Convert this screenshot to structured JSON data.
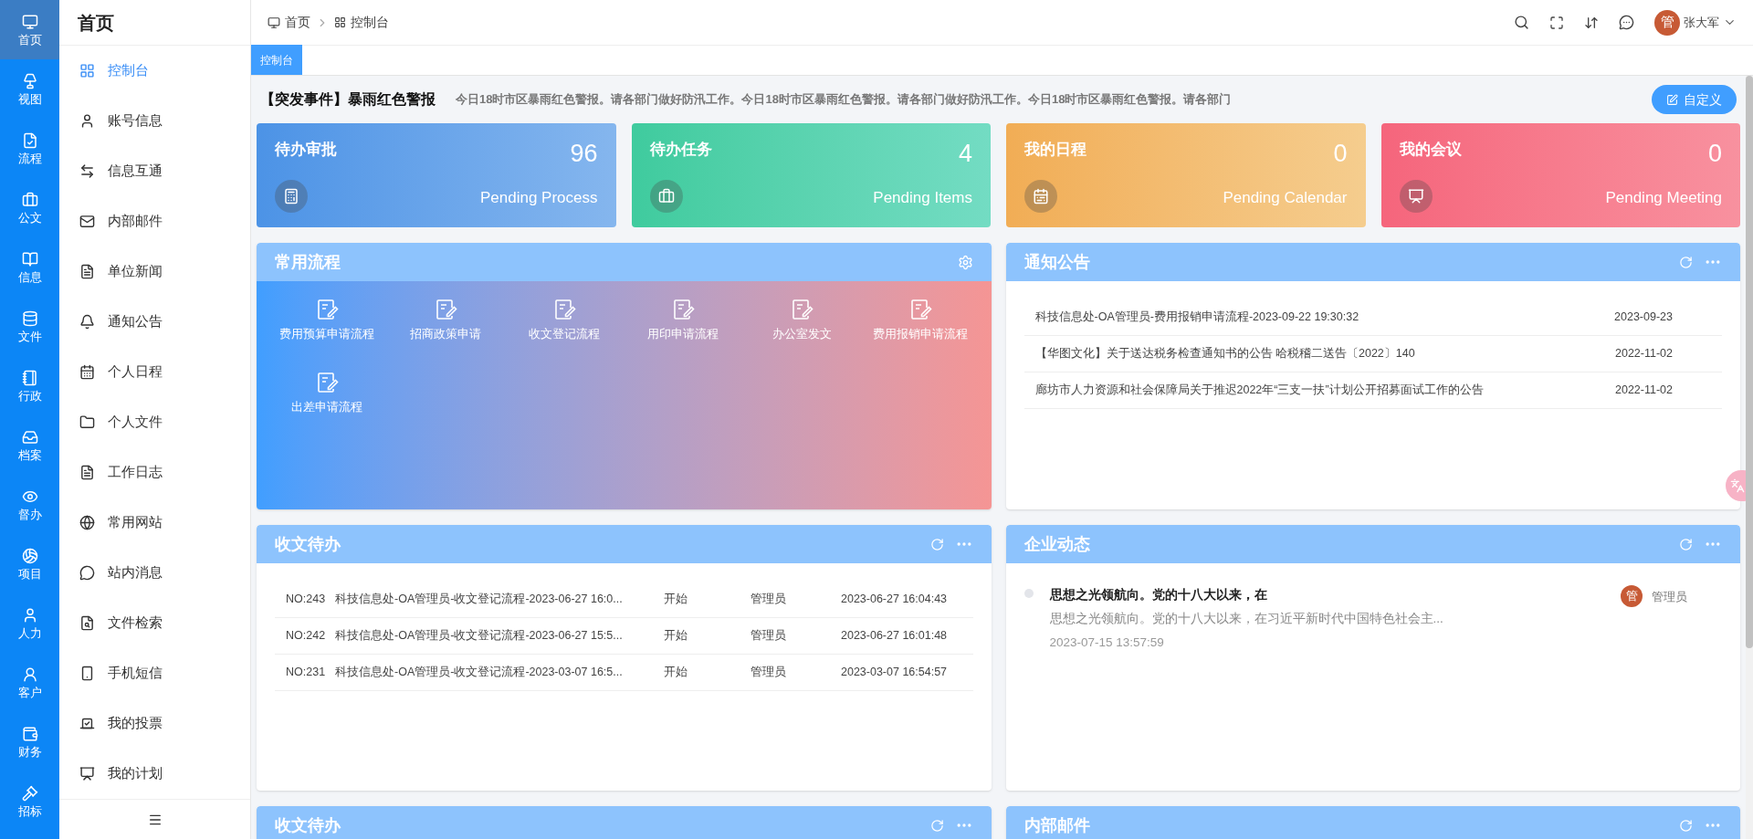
{
  "rail": [
    {
      "label": "首页",
      "selected": true
    },
    {
      "label": "视图",
      "selected": false
    },
    {
      "label": "流程",
      "selected": false
    },
    {
      "label": "公文",
      "selected": false
    },
    {
      "label": "信息",
      "selected": false
    },
    {
      "label": "文件",
      "selected": false
    },
    {
      "label": "行政",
      "selected": false
    },
    {
      "label": "档案",
      "selected": false
    },
    {
      "label": "督办",
      "selected": false
    },
    {
      "label": "项目",
      "selected": false
    },
    {
      "label": "人力",
      "selected": false
    },
    {
      "label": "客户",
      "selected": false
    },
    {
      "label": "财务",
      "selected": false
    },
    {
      "label": "招标",
      "selected": false
    }
  ],
  "sidebar": {
    "title": "首页",
    "items": [
      {
        "label": "控制台",
        "selected": true
      },
      {
        "label": "账号信息",
        "selected": false
      },
      {
        "label": "信息互通",
        "selected": false
      },
      {
        "label": "内部邮件",
        "selected": false
      },
      {
        "label": "单位新闻",
        "selected": false
      },
      {
        "label": "通知公告",
        "selected": false
      },
      {
        "label": "个人日程",
        "selected": false
      },
      {
        "label": "个人文件",
        "selected": false
      },
      {
        "label": "工作日志",
        "selected": false
      },
      {
        "label": "常用网站",
        "selected": false
      },
      {
        "label": "站内消息",
        "selected": false
      },
      {
        "label": "文件检索",
        "selected": false
      },
      {
        "label": "手机短信",
        "selected": false
      },
      {
        "label": "我的投票",
        "selected": false
      },
      {
        "label": "我的计划",
        "selected": false
      }
    ]
  },
  "breadcrumb": [
    "首页",
    "控制台"
  ],
  "user": {
    "avatar_text": "管",
    "name": "张大军"
  },
  "tabs": [
    {
      "label": "控制台",
      "selected": true
    }
  ],
  "alert": {
    "title": "【突发事件】暴雨红色警报",
    "text": "今日18时市区暴雨红色警报。请各部门做好防汛工作。今日18时市区暴雨红色警报。请各部门做好防汛工作。今日18时市区暴雨红色警报。请各部门"
  },
  "customize_button": "自定义",
  "stat_cards": [
    {
      "kind": "approval",
      "title": "待办审批",
      "count": "96",
      "subtitle": "Pending Process"
    },
    {
      "kind": "task",
      "title": "待办任务",
      "count": "4",
      "subtitle": "Pending Items"
    },
    {
      "kind": "calendar",
      "title": "我的日程",
      "count": "0",
      "subtitle": "Pending Calendar"
    },
    {
      "kind": "meeting",
      "title": "我的会议",
      "count": "0",
      "subtitle": "Pending Meeting"
    }
  ],
  "flows": {
    "title": "常用流程",
    "items": [
      "费用预算申请流程",
      "招商政策申请",
      "收文登记流程",
      "用印申请流程",
      "办公室发文",
      "费用报销申请流程",
      "出差申请流程"
    ]
  },
  "notices": {
    "title": "通知公告",
    "rows": [
      {
        "title": "科技信息处-OA管理员-费用报销申请流程-2023-09-22 19:30:32",
        "date": "2023-09-23"
      },
      {
        "title": "【华图文化】关于送达税务检查通知书的公告 哈税稽二送告〔2022〕140",
        "date": "2022-11-02"
      },
      {
        "title": "廊坊市人力资源和社会保障局关于推迟2022年“三支一扶”计划公开招募面试工作的公告",
        "date": "2022-11-02"
      }
    ]
  },
  "inbox": {
    "title": "收文待办",
    "rows": [
      {
        "no": "NO:243",
        "title": "科技信息处-OA管理员-收文登记流程-2023-06-27 16:0...",
        "status": "开始",
        "handler": "管理员",
        "time": "2023-06-27 16:04:43"
      },
      {
        "no": "NO:242",
        "title": "科技信息处-OA管理员-收文登记流程-2023-06-27 15:5...",
        "status": "开始",
        "handler": "管理员",
        "time": "2023-06-27 16:01:48"
      },
      {
        "no": "NO:231",
        "title": "科技信息处-OA管理员-收文登记流程-2023-03-07 16:5...",
        "status": "开始",
        "handler": "管理员",
        "time": "2023-03-07 16:54:57"
      }
    ]
  },
  "news": {
    "title": "企业动态",
    "items": [
      {
        "title": "思想之光领航向。党的十八大以来，在",
        "summary": "思想之光领航向。党的十八大以来，在习近平新时代中国特色社会主...",
        "time": "2023-07-15 13:57:59",
        "avatar_text": "管",
        "author": "管理员"
      }
    ]
  },
  "bottom_panels": [
    {
      "title": "收文待办"
    },
    {
      "title": "内部邮件"
    }
  ]
}
